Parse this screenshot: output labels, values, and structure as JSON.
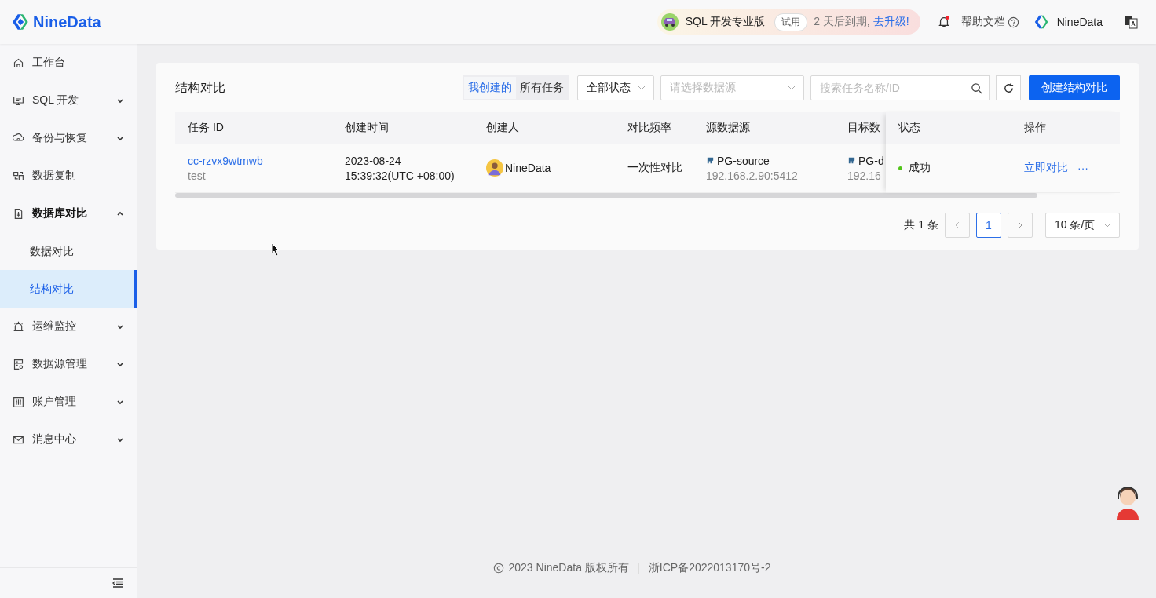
{
  "header": {
    "logo": "NineData",
    "promo": {
      "product": "SQL 开发专业版",
      "badge": "试用",
      "expiry": "2 天后到期,",
      "upgrade": "去升级!"
    },
    "notification": {
      "unread": true
    },
    "help": "帮助文档",
    "user": "NineData"
  },
  "sidebar": {
    "items": [
      {
        "label": "工作台",
        "selected": false
      },
      {
        "label": "SQL 开发",
        "selected": false,
        "expanded": false
      },
      {
        "label": "备份与恢复",
        "selected": false,
        "expanded": false
      },
      {
        "label": "数据复制",
        "selected": false
      },
      {
        "label": "数据库对比",
        "selected": false,
        "expanded": true,
        "children": [
          {
            "label": "数据对比",
            "selected": false
          },
          {
            "label": "结构对比",
            "selected": true
          }
        ]
      },
      {
        "label": "运维监控",
        "selected": false,
        "expanded": false
      },
      {
        "label": "数据源管理",
        "selected": false,
        "expanded": false
      },
      {
        "label": "账户管理",
        "selected": false,
        "expanded": false
      },
      {
        "label": "消息中心",
        "selected": false,
        "expanded": false
      }
    ]
  },
  "panel": {
    "title": "结构对比",
    "scope": [
      {
        "label": "我创建的",
        "selected": true
      },
      {
        "label": "所有任务",
        "selected": false
      }
    ],
    "status_filter": "全部状态",
    "datasource_filter": {
      "placeholder": "请选择数据源"
    },
    "search": {
      "placeholder": "搜索任务名称/ID"
    },
    "create_button": "创建结构对比",
    "table": {
      "columns": [
        "任务 ID",
        "创建时间",
        "创建人",
        "对比频率",
        "源数据源",
        "目标数"
      ],
      "fixed_columns": [
        "状态",
        "操作"
      ],
      "rows": [
        {
          "id": "cc-rzvx9wtmwb",
          "name": "test",
          "date": "2023-08-24",
          "time": "15:39:32(UTC +08:00)",
          "creator": "NineData",
          "frequency": "一次性对比",
          "source": {
            "name": "PG-source",
            "address": "192.168.2.90:5412"
          },
          "target": {
            "name": "PG-d",
            "address": "192.16"
          },
          "status": {
            "label": "成功",
            "color": "#52c41a"
          },
          "action": "立即对比",
          "more": "···"
        }
      ]
    },
    "pagination": {
      "total": "共 1 条",
      "pages": [
        {
          "label": "1",
          "selected": true
        }
      ],
      "page_size": "10 条/页"
    }
  },
  "footer": {
    "copyright": "2023 NineData 版权所有",
    "icp": "浙ICP备2022013170号-2"
  }
}
